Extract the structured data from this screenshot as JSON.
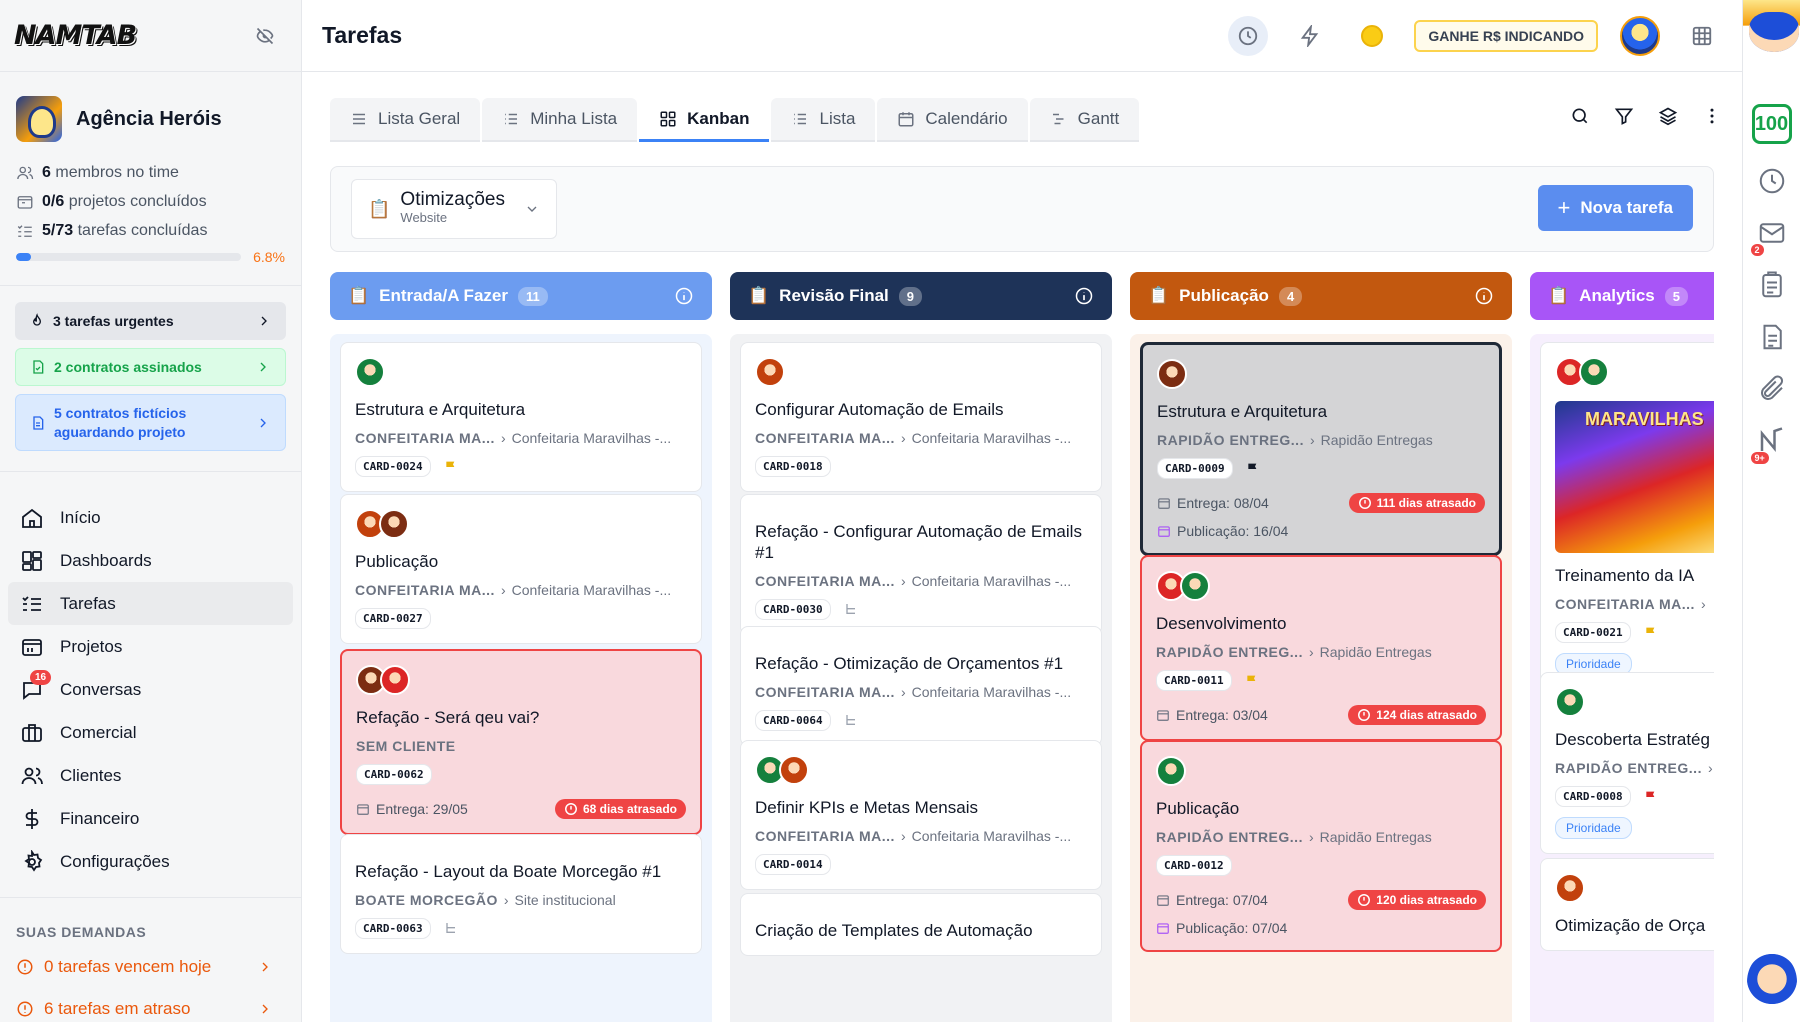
{
  "app": {
    "logo": "NAMTAB",
    "page_title": "Tarefas"
  },
  "agency": {
    "name": "Agência Heróis",
    "members_count": "6",
    "members_label": "membros no time",
    "projects_count": "0/6",
    "projects_label": "projetos concluídos",
    "tasks_count": "5/73",
    "tasks_label": "tarefas concluídas",
    "progress_pct": 6.8,
    "progress_label": "6.8%"
  },
  "alerts": {
    "urgent": "3 tarefas urgentes",
    "contracts": "2 contratos assinados",
    "fictitious": "5 contratos fictícios aguardando projeto"
  },
  "nav": [
    {
      "label": "Início",
      "icon": "home-icon"
    },
    {
      "label": "Dashboards",
      "icon": "dashboard-icon"
    },
    {
      "label": "Tarefas",
      "icon": "tasks-icon",
      "active": true
    },
    {
      "label": "Projetos",
      "icon": "projects-icon"
    },
    {
      "label": "Conversas",
      "icon": "chat-icon",
      "badge": "16"
    },
    {
      "label": "Comercial",
      "icon": "briefcase-icon"
    },
    {
      "label": "Clientes",
      "icon": "users-icon"
    },
    {
      "label": "Financeiro",
      "icon": "dollar-icon"
    },
    {
      "label": "Configurações",
      "icon": "gear-icon"
    }
  ],
  "demands": {
    "title": "SUAS DEMANDAS",
    "today": "0 tarefas vencem hoje",
    "late": "6 tarefas em atraso"
  },
  "topbar": {
    "earn_label": "GANHE R$ INDICANDO"
  },
  "tabs": [
    "Lista Geral",
    "Minha Lista",
    "Kanban",
    "Lista",
    "Calendário",
    "Gantt"
  ],
  "project_select": {
    "name": "Otimizações",
    "sub": "Website"
  },
  "new_task_label": "Nova tarefa",
  "rail": {
    "score": "100",
    "mail_badge": "2",
    "notif_badge": "9+"
  },
  "colors": {
    "accent": "#3b82f6",
    "late": "#ef4444",
    "entrada": "#6c9cf0",
    "revisao": "#1e3358",
    "publicacao": "#c2580f",
    "analytics": "#a855f7"
  },
  "columns": [
    {
      "title": "Entrada/A Fazer",
      "count": "11",
      "cards": [
        {
          "title": "Estrutura e Arquitetura",
          "client": "CONFEITARIA MA...",
          "project": "Confeitaria Maravilhas -...",
          "code": "CARD-0024",
          "flag": "yellow"
        },
        {
          "title": "Publicação",
          "client": "CONFEITARIA MA...",
          "project": "Confeitaria Maravilhas -...",
          "code": "CARD-0027"
        },
        {
          "title": "Refação - Será qeu vai?",
          "client": "SEM CLIENTE",
          "code": "CARD-0062",
          "delivery": "Entrega: 29/05",
          "late": "68 dias atrasado"
        },
        {
          "title": "Refação - Layout da Boate Morcegão #1",
          "client": "BOATE MORCEGÃO",
          "project": "Site institucional",
          "code": "CARD-0063"
        }
      ]
    },
    {
      "title": "Revisão Final",
      "count": "9",
      "cards": [
        {
          "title": "Configurar Automação de Emails",
          "client": "CONFEITARIA MA...",
          "project": "Confeitaria Maravilhas -...",
          "code": "CARD-0018"
        },
        {
          "title": "Refação - Configurar Automação de Emails #1",
          "client": "CONFEITARIA MA...",
          "project": "Confeitaria Maravilhas -...",
          "code": "CARD-0030"
        },
        {
          "title": "Refação - Otimização de Orçamentos #1",
          "client": "CONFEITARIA MA...",
          "project": "Confeitaria Maravilhas -...",
          "code": "CARD-0064"
        },
        {
          "title": "Definir KPIs e Metas Mensais",
          "client": "CONFEITARIA MA...",
          "project": "Confeitaria Maravilhas -...",
          "code": "CARD-0014"
        },
        {
          "title": "Criação de Templates de Automação"
        }
      ]
    },
    {
      "title": "Publicação",
      "count": "4",
      "cards": [
        {
          "title": "Estrutura e Arquitetura",
          "client": "RAPIDÃO ENTREG...",
          "project": "Rapidão Entregas",
          "code": "CARD-0009",
          "flag": "black",
          "delivery": "Entrega: 08/04",
          "late": "111 dias atrasado",
          "publication": "Publicação: 16/04"
        },
        {
          "title": "Desenvolvimento",
          "client": "RAPIDÃO ENTREG...",
          "project": "Rapidão Entregas",
          "code": "CARD-0011",
          "flag": "yellow",
          "delivery": "Entrega: 03/04",
          "late": "124 dias atrasado"
        },
        {
          "title": "Publicação",
          "client": "RAPIDÃO ENTREG...",
          "project": "Rapidão Entregas",
          "code": "CARD-0012",
          "delivery": "Entrega: 07/04",
          "late": "120 dias atrasado",
          "publication": "Publicação: 07/04"
        }
      ]
    },
    {
      "title": "Analytics",
      "count": "5",
      "cards": [
        {
          "title": "Treinamento da IA",
          "client": "CONFEITARIA MA...",
          "code": "CARD-0021",
          "flag": "yellow",
          "priority": "Prioridade",
          "thumb_text": "MARAVILHAS"
        },
        {
          "title": "Descoberta Estratég",
          "client": "RAPIDÃO ENTREG...",
          "code": "CARD-0008",
          "flag": "red",
          "priority": "Prioridade"
        },
        {
          "title": "Otimização de Orça"
        }
      ]
    }
  ]
}
